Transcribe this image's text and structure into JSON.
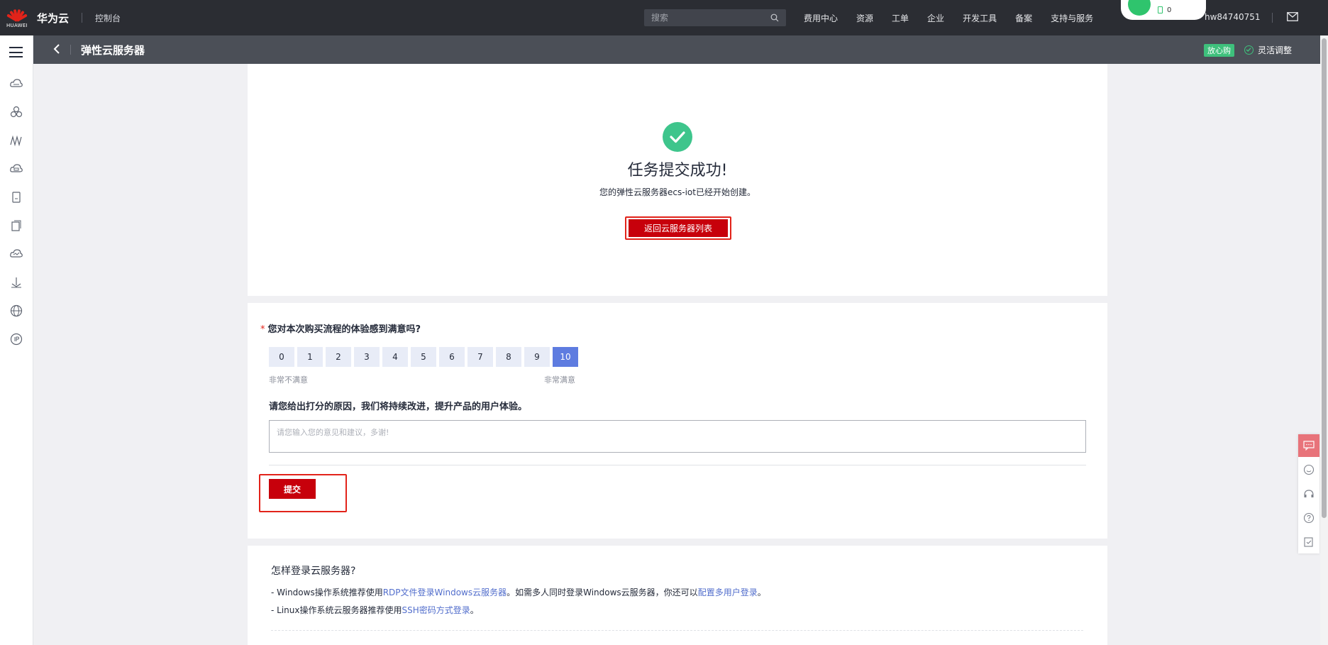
{
  "topbar": {
    "logo_text": "HUAWEI",
    "brand": "华为云",
    "console": "控制台",
    "search_placeholder": "搜索",
    "nav": [
      "费用中心",
      "资源",
      "工单",
      "企业",
      "开发工具",
      "备案",
      "支持与服务"
    ],
    "user": "hw84740751",
    "popup_count": "0"
  },
  "subheader": {
    "title": "弹性云服务器",
    "badge": "放心购",
    "flex_adjust": "灵活调整"
  },
  "success": {
    "title": "任务提交成功!",
    "description": "您的弹性云服务器ecs-iot已经开始创建。",
    "back_button": "返回云服务器列表"
  },
  "survey": {
    "question": "您对本次购买流程的体验感到满意吗?",
    "scores": [
      "0",
      "1",
      "2",
      "3",
      "4",
      "5",
      "6",
      "7",
      "8",
      "9",
      "10"
    ],
    "selected": "10",
    "label_low": "非常不满意",
    "label_high": "非常满意",
    "reason_title": "请您给出打分的原因，我们将持续改进，提升产品的用户体验。",
    "feedback_placeholder": "请您输入您的意见和建议，多谢!",
    "submit": "提交"
  },
  "howto": {
    "title": "怎样登录云服务器?",
    "windows": {
      "prefix": "- Windows操作系统推荐使用",
      "link1": "RDP文件登录Windows云服务器",
      "middle": "。如需多人同时登录Windows云服务器，你还可以",
      "link2": "配置多用户登录",
      "suffix": "。"
    },
    "linux": {
      "prefix": "- Linux操作系统云服务器推荐使用",
      "link": "SSH密码方式登录",
      "suffix": "。"
    }
  },
  "colors": {
    "accent_red": "#c7000b",
    "success_green": "#3ec58c",
    "selected_blue": "#5e7ce0",
    "link_blue": "#526ecc"
  }
}
